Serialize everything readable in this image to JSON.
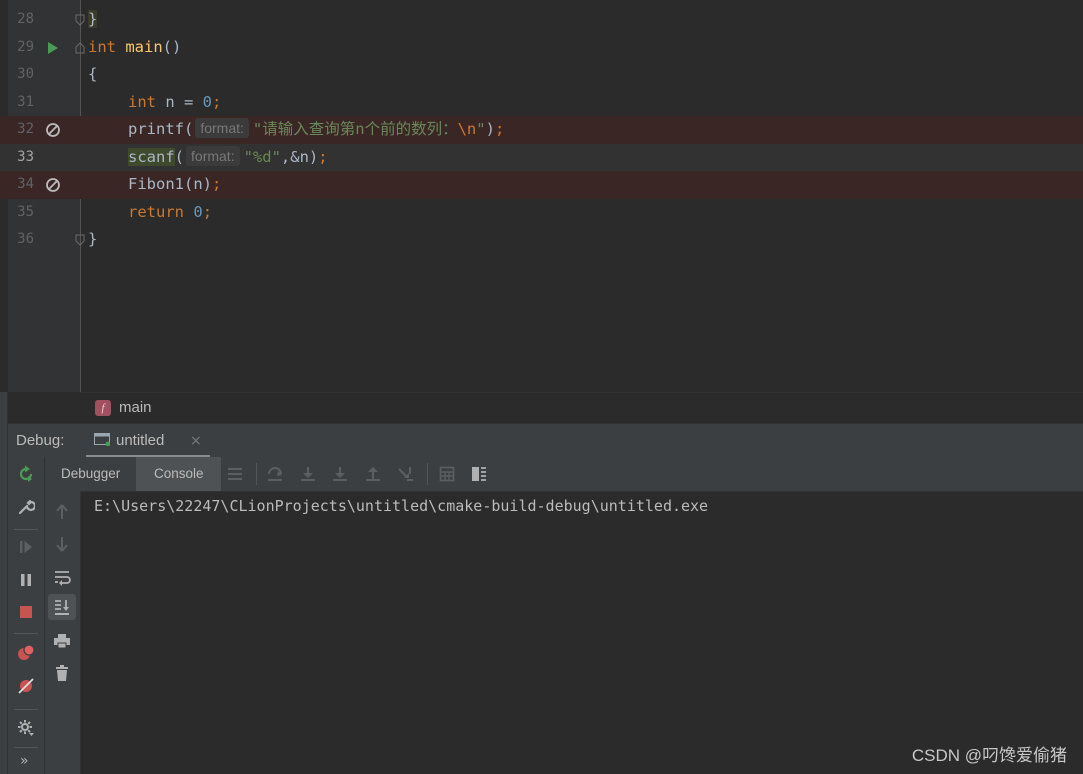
{
  "editor": {
    "lines": [
      {
        "num": "28"
      },
      {
        "num": "29"
      },
      {
        "num": "30"
      },
      {
        "num": "31"
      },
      {
        "num": "32"
      },
      {
        "num": "33"
      },
      {
        "num": "34"
      },
      {
        "num": "35"
      },
      {
        "num": "36"
      }
    ],
    "tokens": {
      "close_brace": "}",
      "int_kw": "int",
      "main_fn": "main",
      "parens": "()",
      "open_brace": "{",
      "int_kw2": "int",
      "n_decl": " n = ",
      "zero": "0",
      "semi": ";",
      "printf": "printf(",
      "printf_hint": "format:",
      "printf_str": "\"请输入查询第n个前的数列：",
      "printf_esc": "\\n",
      "printf_str_end": "\"",
      "printf_close": ")",
      "scanf": "scanf",
      "scanf_paren": "(",
      "scanf_hint": "format:",
      "scanf_str": "\"%d\"",
      "scanf_rest": ",&n)",
      "fibon_call": "Fibon1(n)",
      "return_kw": "return",
      "return_val": "0",
      "end_brace": "}"
    },
    "breadcrumb": {
      "icon_letter": "f",
      "label": "main"
    }
  },
  "debug": {
    "title": "Debug:",
    "run_tab": "untitled",
    "run_tab_close": "×",
    "tabs": [
      "Debugger",
      "Console"
    ],
    "console_output": "E:\\Users\\22247\\CLionProjects\\untitled\\cmake-build-debug\\untitled.exe",
    "more_label": "»"
  },
  "watermark": "CSDN @叼馋爱偷猪",
  "colors": {
    "background": "#2b2b2b",
    "keyword": "#cc7832",
    "function": "#ffc66d",
    "number": "#6897bb",
    "string": "#6a8759",
    "error_line": "#3b2626",
    "run_green": "#499c54",
    "stop_red": "#c75450"
  }
}
